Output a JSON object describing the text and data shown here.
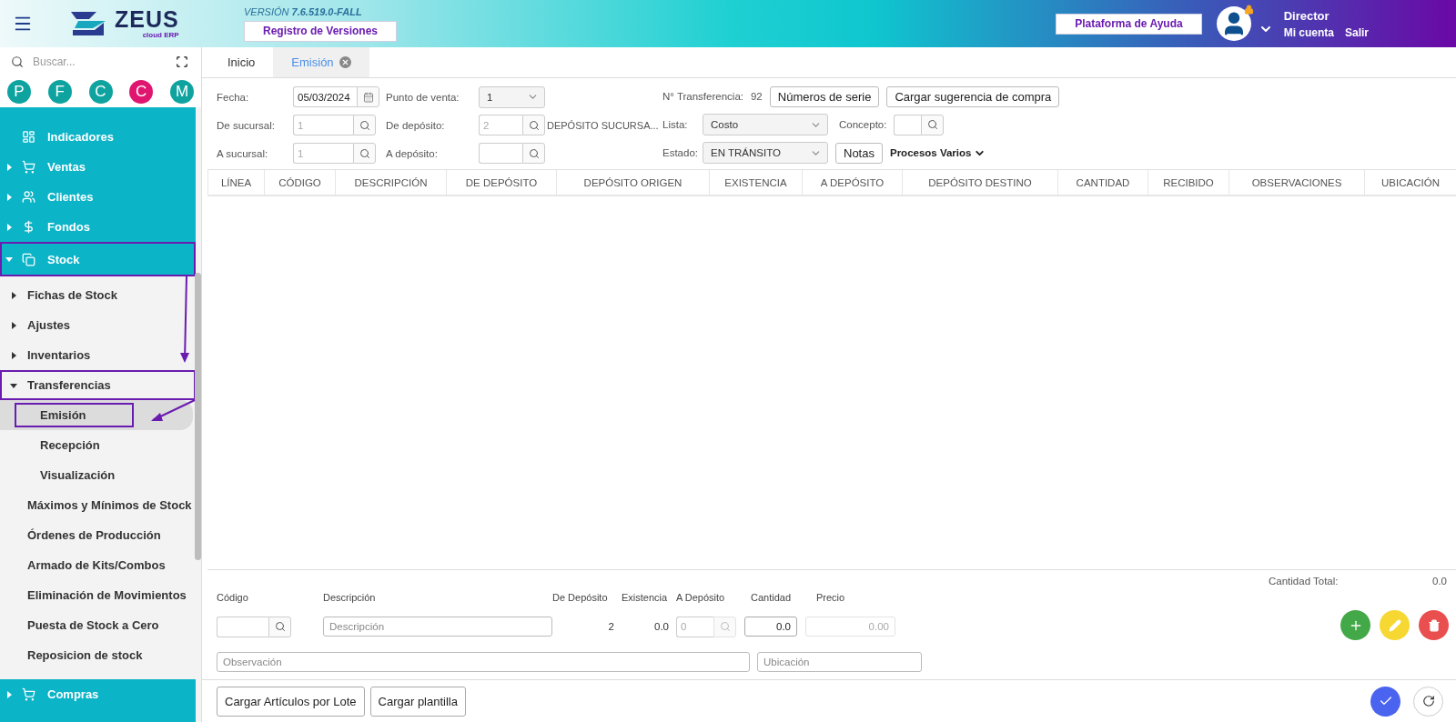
{
  "header": {
    "logo": {
      "name": "ZEUS",
      "tagline": "cloud ERP"
    },
    "version_label": "VERSIÓN",
    "version": "7.6.519.0-FALL",
    "versions_button": "Registro de Versiones",
    "help_button": "Plataforma de Ayuda",
    "user": {
      "role": "Director",
      "account_link": "Mi cuenta",
      "logout_link": "Salir",
      "locked": true
    }
  },
  "sidebar": {
    "search": {
      "placeholder": "Buscar..."
    },
    "shortcuts": [
      {
        "letter": "P",
        "color": "#0fa3a0"
      },
      {
        "letter": "F",
        "color": "#0fa3a0"
      },
      {
        "letter": "C",
        "color": "#0fa3a0"
      },
      {
        "letter": "C",
        "color": "#e0156f"
      },
      {
        "letter": "M",
        "color": "#0fa3a0"
      }
    ],
    "menu": [
      {
        "label": "Indicadores",
        "kind": "leaf",
        "selected": false,
        "annotated": false
      },
      {
        "label": "Ventas",
        "kind": "group",
        "expanded": false,
        "selected": false,
        "annotated": false
      },
      {
        "label": "Clientes",
        "kind": "group",
        "expanded": false,
        "selected": false,
        "annotated": false
      },
      {
        "label": "Fondos",
        "kind": "group",
        "expanded": false,
        "selected": false,
        "annotated": false
      },
      {
        "label": "Stock",
        "kind": "group",
        "expanded": true,
        "selected": false,
        "annotated": true,
        "children": [
          {
            "label": "Fichas de Stock",
            "kind": "group",
            "expanded": false,
            "selected": false,
            "annotated": false
          },
          {
            "label": "Ajustes",
            "kind": "group",
            "expanded": false,
            "selected": false,
            "annotated": false
          },
          {
            "label": "Inventarios",
            "kind": "group",
            "expanded": false,
            "selected": false,
            "annotated": false
          },
          {
            "label": "Transferencias",
            "kind": "group",
            "expanded": true,
            "selected": false,
            "annotated": true,
            "children": [
              {
                "label": "Emisión",
                "selected": true,
                "annotated": true
              },
              {
                "label": "Recepción",
                "selected": false,
                "annotated": false
              },
              {
                "label": "Visualización",
                "selected": false,
                "annotated": false
              }
            ]
          },
          {
            "label": "Máximos y Mínimos de Stock",
            "kind": "leaf",
            "selected": false,
            "annotated": false
          },
          {
            "label": "Órdenes de Producción",
            "kind": "leaf",
            "selected": false,
            "annotated": false
          },
          {
            "label": "Armado de Kits/Combos",
            "kind": "leaf",
            "selected": false,
            "annotated": false
          },
          {
            "label": "Eliminación de Movimientos",
            "kind": "leaf",
            "selected": false,
            "annotated": false
          },
          {
            "label": "Puesta de Stock a Cero",
            "kind": "leaf",
            "selected": false,
            "annotated": false
          },
          {
            "label": "Reposicion de stock",
            "kind": "leaf",
            "selected": false,
            "annotated": false
          }
        ]
      },
      {
        "label": "Compras",
        "kind": "group",
        "expanded": false,
        "selected": false,
        "annotated": false
      }
    ]
  },
  "tabs": [
    {
      "label": "Inicio",
      "selected": false,
      "closable": false
    },
    {
      "label": "Emisión",
      "selected": true,
      "closable": true
    }
  ],
  "form": {
    "fecha": {
      "label": "Fecha:",
      "value": "05/03/2024"
    },
    "punto_de_venta": {
      "label": "Punto de venta:",
      "value": "1"
    },
    "de_sucursal": {
      "label": "De sucursal:",
      "value": "1",
      "disabled": true
    },
    "de_deposito": {
      "label": "De depósito:",
      "value": "2",
      "disabled": true,
      "name": "DEPÓSITO SUCURSA..."
    },
    "a_sucursal": {
      "label": "A sucursal:",
      "value": "1",
      "disabled": true
    },
    "a_deposito": {
      "label": "A depósito:"
    },
    "transferencia": {
      "label": "N° Transferencia:",
      "value": "92"
    },
    "buttons": [
      "Números de serie",
      "Cargar sugerencia de compra"
    ],
    "lista": {
      "label": "Lista:",
      "value": "Costo"
    },
    "concepto": {
      "label": "Concepto:"
    },
    "estado": {
      "label": "Estado:",
      "value": "EN TRÁNSITO"
    },
    "notes_button": "Notas",
    "more_menu": "Procesos Varios"
  },
  "table": {
    "columns": [
      "LÍNEA",
      "CÓDIGO",
      "DESCRIPCIÓN",
      "DE DEPÓSITO",
      "DEPÓSITO ORIGEN",
      "EXISTENCIA",
      "A DEPÓSITO",
      "DEPÓSITO DESTINO",
      "CANTIDAD",
      "RECIBIDO",
      "OBSERVACIONES",
      "UBICACIÓN"
    ]
  },
  "total": {
    "label": "Cantidad Total:",
    "value": "0.0"
  },
  "entry": {
    "labels": [
      "Código",
      "Descripción",
      "De Depósito",
      "Existencia",
      "A Depósito",
      "Cantidad",
      "Precio"
    ],
    "description_placeholder": "Descripción",
    "from_deposit": "2",
    "stock": "0.0",
    "to_deposit": {
      "value": "0",
      "disabled": true
    },
    "quantity": "0.0",
    "price": {
      "value": "0.00",
      "disabled": true
    },
    "observation_placeholder": "Observación",
    "location_placeholder": "Ubicación"
  },
  "footer_buttons": [
    "Cargar Artículos por Lote",
    "Cargar plantilla"
  ]
}
